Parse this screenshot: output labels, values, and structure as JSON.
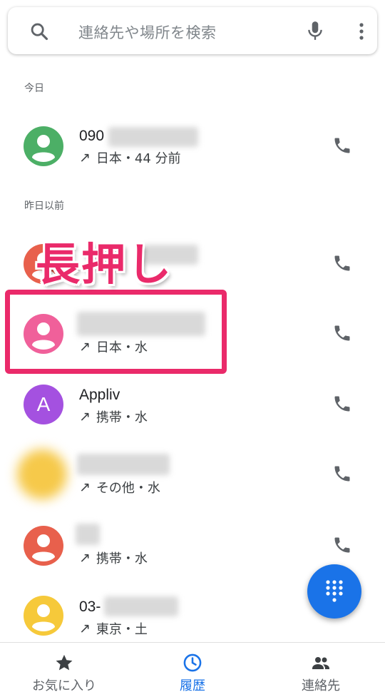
{
  "search": {
    "placeholder": "連絡先や場所を検索",
    "search_icon": "search-icon",
    "mic_icon": "mic-icon",
    "more_icon": "more-vert-icon"
  },
  "sections": {
    "today": "今日",
    "older": "昨日以前"
  },
  "calls": [
    {
      "name": "090",
      "detail": "日本・44 分前",
      "avatar_color": "#4caf66",
      "avatar_type": "person"
    },
    {
      "name": "",
      "detail": "",
      "avatar_color": "#e8604c",
      "avatar_type": "person"
    },
    {
      "name": "",
      "detail": "日本・水",
      "avatar_color": "#f0609a",
      "avatar_type": "person"
    },
    {
      "name": "Appliv",
      "detail": "携帯・水",
      "avatar_color": "#a451e0",
      "avatar_type": "letter",
      "letter": "A"
    },
    {
      "name": "",
      "detail": "その他・水",
      "avatar_color": "#f6c94a",
      "avatar_type": "blurred"
    },
    {
      "name": "",
      "detail": "携帯・水",
      "avatar_color": "#e8604c",
      "avatar_type": "person"
    },
    {
      "name": "03-",
      "detail": "東京・土",
      "avatar_color": "#f6c93a",
      "avatar_type": "person"
    }
  ],
  "overlay": {
    "label": "長押し",
    "color": "#ea2a6a"
  },
  "fab": {
    "icon": "dialpad-icon",
    "color": "#1a73e8"
  },
  "nav": {
    "favorites": "お気に入り",
    "history": "履歴",
    "contacts": "連絡先",
    "active": "history",
    "accent": "#1a73e8"
  }
}
